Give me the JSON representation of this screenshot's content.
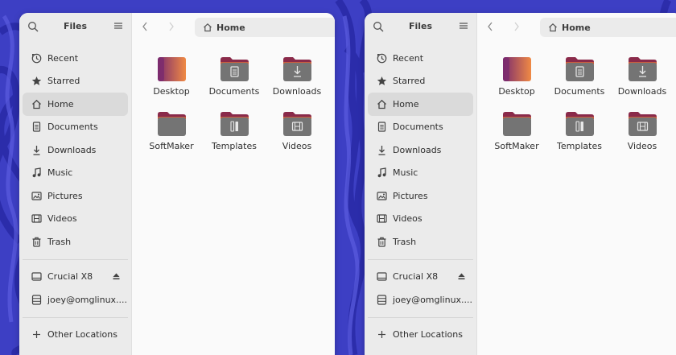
{
  "windows": [
    {
      "sidebar": {
        "title": "Files",
        "places": [
          {
            "label": "Recent",
            "icon": "clock-icon",
            "active": false
          },
          {
            "label": "Starred",
            "icon": "star-icon",
            "active": false
          },
          {
            "label": "Home",
            "icon": "home-icon",
            "active": true
          },
          {
            "label": "Documents",
            "icon": "document-icon",
            "active": false
          },
          {
            "label": "Downloads",
            "icon": "download-icon",
            "active": false
          },
          {
            "label": "Music",
            "icon": "music-icon",
            "active": false
          },
          {
            "label": "Pictures",
            "icon": "picture-icon",
            "active": false
          },
          {
            "label": "Videos",
            "icon": "video-icon",
            "active": false
          },
          {
            "label": "Trash",
            "icon": "trash-icon",
            "active": false
          }
        ],
        "devices": [
          {
            "label": "Crucial X8",
            "icon": "drive-icon",
            "eject": true
          },
          {
            "label": "joey@omglinux....",
            "icon": "server-icon",
            "eject": false
          }
        ],
        "other": {
          "label": "Other Locations",
          "icon": "plus-icon"
        }
      },
      "path": {
        "label": "Home",
        "icon": "home-icon"
      },
      "files": [
        {
          "label": "Desktop",
          "icon": "desktop-folder-icon"
        },
        {
          "label": "Documents",
          "icon": "documents-folder-icon"
        },
        {
          "label": "Downloads",
          "icon": "downloads-folder-icon"
        },
        {
          "label": "SoftMaker",
          "icon": "folder-icon"
        },
        {
          "label": "Templates",
          "icon": "templates-folder-icon"
        },
        {
          "label": "Videos",
          "icon": "videos-folder-icon"
        }
      ]
    },
    {
      "sidebar": {
        "title": "Files",
        "places": [
          {
            "label": "Recent",
            "icon": "clock-icon",
            "active": false
          },
          {
            "label": "Starred",
            "icon": "star-icon",
            "active": false
          },
          {
            "label": "Home",
            "icon": "home-icon",
            "active": true
          },
          {
            "label": "Documents",
            "icon": "document-icon",
            "active": false
          },
          {
            "label": "Downloads",
            "icon": "download-icon",
            "active": false
          },
          {
            "label": "Music",
            "icon": "music-icon",
            "active": false
          },
          {
            "label": "Pictures",
            "icon": "picture-icon",
            "active": false
          },
          {
            "label": "Videos",
            "icon": "video-icon",
            "active": false
          },
          {
            "label": "Trash",
            "icon": "trash-icon",
            "active": false
          }
        ],
        "devices": [
          {
            "label": "Crucial X8",
            "icon": "drive-icon",
            "eject": true
          },
          {
            "label": "joey@omglinux....",
            "icon": "server-icon",
            "eject": false
          }
        ],
        "other": {
          "label": "Other Locations",
          "icon": "plus-icon"
        }
      },
      "path": {
        "label": "Home",
        "icon": "home-icon"
      },
      "files": [
        {
          "label": "Desktop",
          "icon": "desktop-folder-icon"
        },
        {
          "label": "Documents",
          "icon": "documents-folder-icon"
        },
        {
          "label": "Downloads",
          "icon": "downloads-folder-icon"
        },
        {
          "label": "SoftMaker",
          "icon": "folder-icon"
        },
        {
          "label": "Templates",
          "icon": "templates-folder-icon"
        },
        {
          "label": "Videos",
          "icon": "videos-folder-icon"
        }
      ]
    }
  ],
  "colors": {
    "desktop_background": "#3d3fc4",
    "folder_tab": "#8a2a4a",
    "folder_body": "#747474",
    "desktop_gradient_start": "#7b2b6e",
    "desktop_gradient_end": "#f08a44"
  }
}
